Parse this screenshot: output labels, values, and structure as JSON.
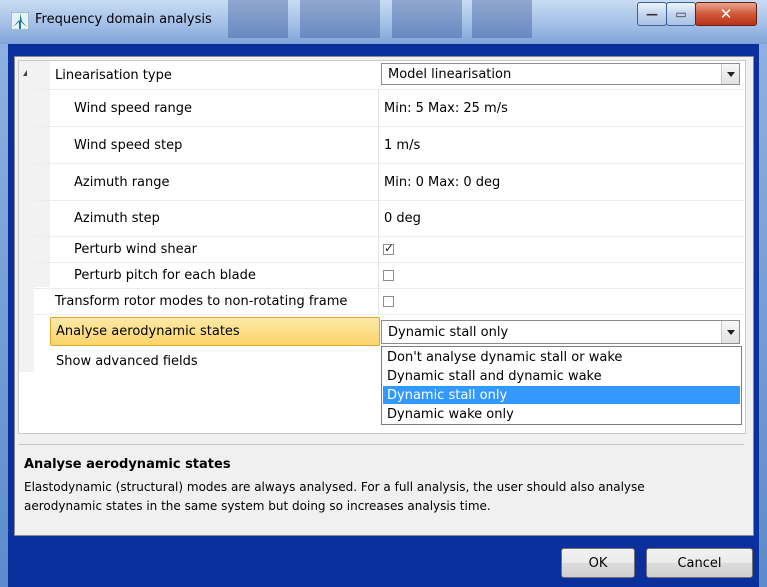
{
  "window": {
    "title": "Frequency domain analysis",
    "buttons": {
      "minimize": "—",
      "maximize": "▭",
      "close": "✕"
    }
  },
  "properties": [
    {
      "key": "linearisation_type",
      "label": "Linearisation type",
      "value": "Model linearisation",
      "kind": "dropdown"
    },
    {
      "key": "wind_speed_range",
      "label": "Wind speed range",
      "value": "Min: 5  Max: 25   m/s",
      "kind": "text"
    },
    {
      "key": "wind_speed_step",
      "label": "Wind speed step",
      "value": "1   m/s",
      "kind": "text"
    },
    {
      "key": "azimuth_range",
      "label": "Azimuth range",
      "value": "Min: 0  Max: 0   deg",
      "kind": "text"
    },
    {
      "key": "azimuth_step",
      "label": "Azimuth step",
      "value": "0   deg",
      "kind": "text"
    },
    {
      "key": "perturb_wind_shear",
      "label": "Perturb wind shear",
      "checked": true,
      "kind": "checkbox"
    },
    {
      "key": "perturb_pitch",
      "label": "Perturb pitch for each blade",
      "checked": false,
      "kind": "checkbox"
    },
    {
      "key": "transform_rotor",
      "label": "Transform rotor modes to non-rotating frame",
      "checked": false,
      "kind": "checkbox"
    },
    {
      "key": "analyse_aero",
      "label": "Analyse aerodynamic states",
      "value": "Dynamic stall only",
      "kind": "dropdown",
      "selected": true
    },
    {
      "key": "show_advanced",
      "label": "Show advanced fields",
      "kind": "none"
    }
  ],
  "aero_dropdown": {
    "options": [
      "Don't analyse dynamic stall or wake",
      "Dynamic stall and dynamic wake",
      "Dynamic stall only",
      "Dynamic wake only"
    ],
    "highlighted_index": 2
  },
  "description": {
    "title": "Analyse aerodynamic states",
    "body": "Elastodynamic (structural) modes are always analysed. For a full analysis, the user should also analyse aerodynamic states in the same system but doing so increases analysis time."
  },
  "footer": {
    "ok_label": "OK",
    "cancel_label": "Cancel"
  },
  "colors": {
    "highlight": "#3399ff",
    "selected_row": "#fbd46c",
    "client_bg": "#0c2f9e"
  },
  "icons": {
    "app": "bladed-app-icon",
    "expander": "collapse-triangle-icon"
  }
}
